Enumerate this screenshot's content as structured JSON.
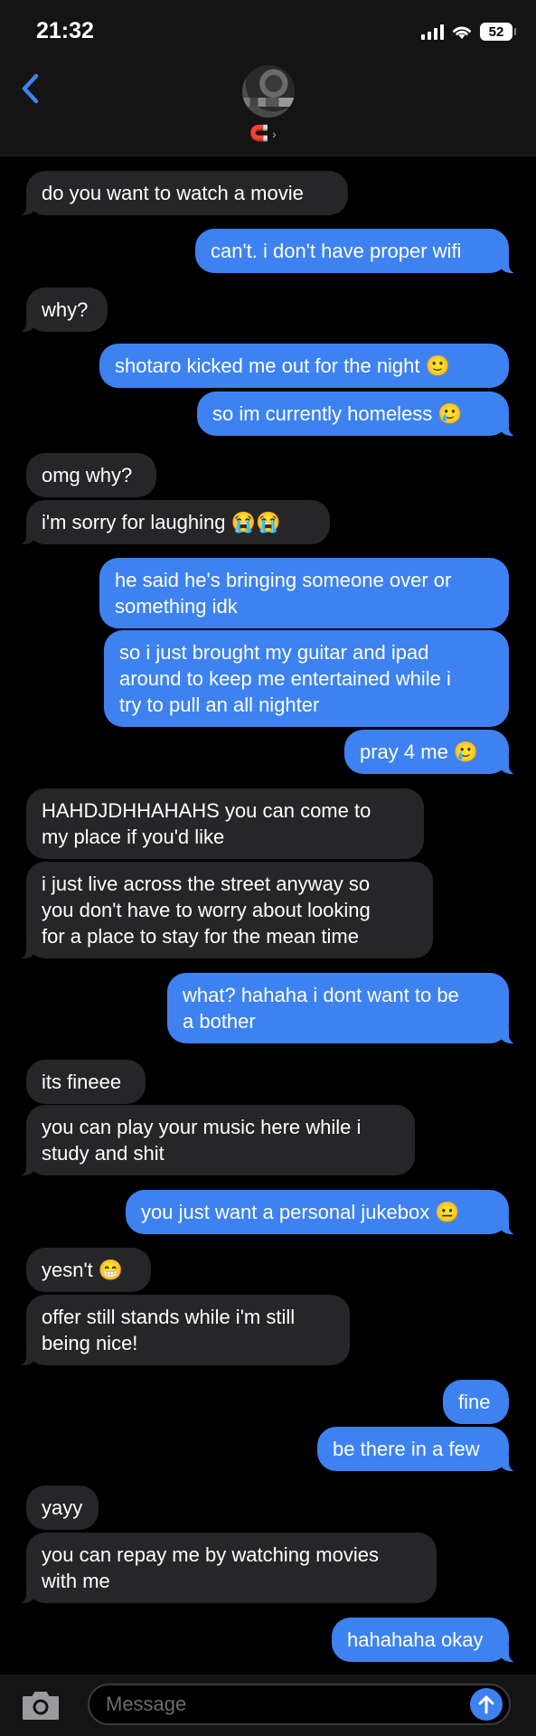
{
  "status_bar": {
    "time": "21:32",
    "battery": "52",
    "icons": [
      "signal-icon",
      "wifi-icon",
      "battery-icon"
    ]
  },
  "header": {
    "back_icon": "chevron-left-icon",
    "contact_emoji": "🧲",
    "contact_chevron": "›"
  },
  "colors": {
    "sent_bubble": "#3d82f0",
    "received_bubble": "#262628",
    "background": "#000000",
    "accent": "#3d82f0"
  },
  "messages": [
    {
      "from": "them",
      "text": "do you want to watch a movie"
    },
    {
      "from": "me",
      "text": "can't. i don't have proper wifi"
    },
    {
      "from": "them",
      "text": "why?"
    },
    {
      "from": "me",
      "text": "shotaro kicked me out for the night 🙂"
    },
    {
      "from": "me",
      "text": "so im currently homeless 🥲"
    },
    {
      "from": "them",
      "text": "omg why?"
    },
    {
      "from": "them",
      "text": "i'm sorry for laughing 😭😭"
    },
    {
      "from": "me",
      "text": "he said he's bringing someone over or\nsomething idk"
    },
    {
      "from": "me",
      "text": "so i just brought my guitar and ipad\naround to keep me entertained while i\ntry to pull an all nighter"
    },
    {
      "from": "me",
      "text": "pray 4 me 🥲"
    },
    {
      "from": "them",
      "text": "HAHDJDHHAHAHS you can come to\nmy place if you'd like"
    },
    {
      "from": "them",
      "text": "i just live across the street anyway so\nyou don't have to worry about looking\nfor a place to stay for the mean time"
    },
    {
      "from": "me",
      "text": "what? hahaha i dont want to be\na bother"
    },
    {
      "from": "them",
      "text": "its fineee"
    },
    {
      "from": "them",
      "text": "you can play your music here while i\nstudy and shit"
    },
    {
      "from": "me",
      "text": "you just want a personal jukebox 😐"
    },
    {
      "from": "them",
      "text": "yesn't 😁"
    },
    {
      "from": "them",
      "text": "offer still stands while i'm still\nbeing nice!"
    },
    {
      "from": "me",
      "text": "fine"
    },
    {
      "from": "me",
      "text": "be there in a few"
    },
    {
      "from": "them",
      "text": "yayy"
    },
    {
      "from": "them",
      "text": "you can repay me by watching movies\nwith me"
    },
    {
      "from": "me",
      "text": "hahahaha okay"
    }
  ],
  "input_bar": {
    "placeholder": "Message",
    "camera_icon": "camera-icon",
    "send_icon": "arrow-up-icon"
  }
}
